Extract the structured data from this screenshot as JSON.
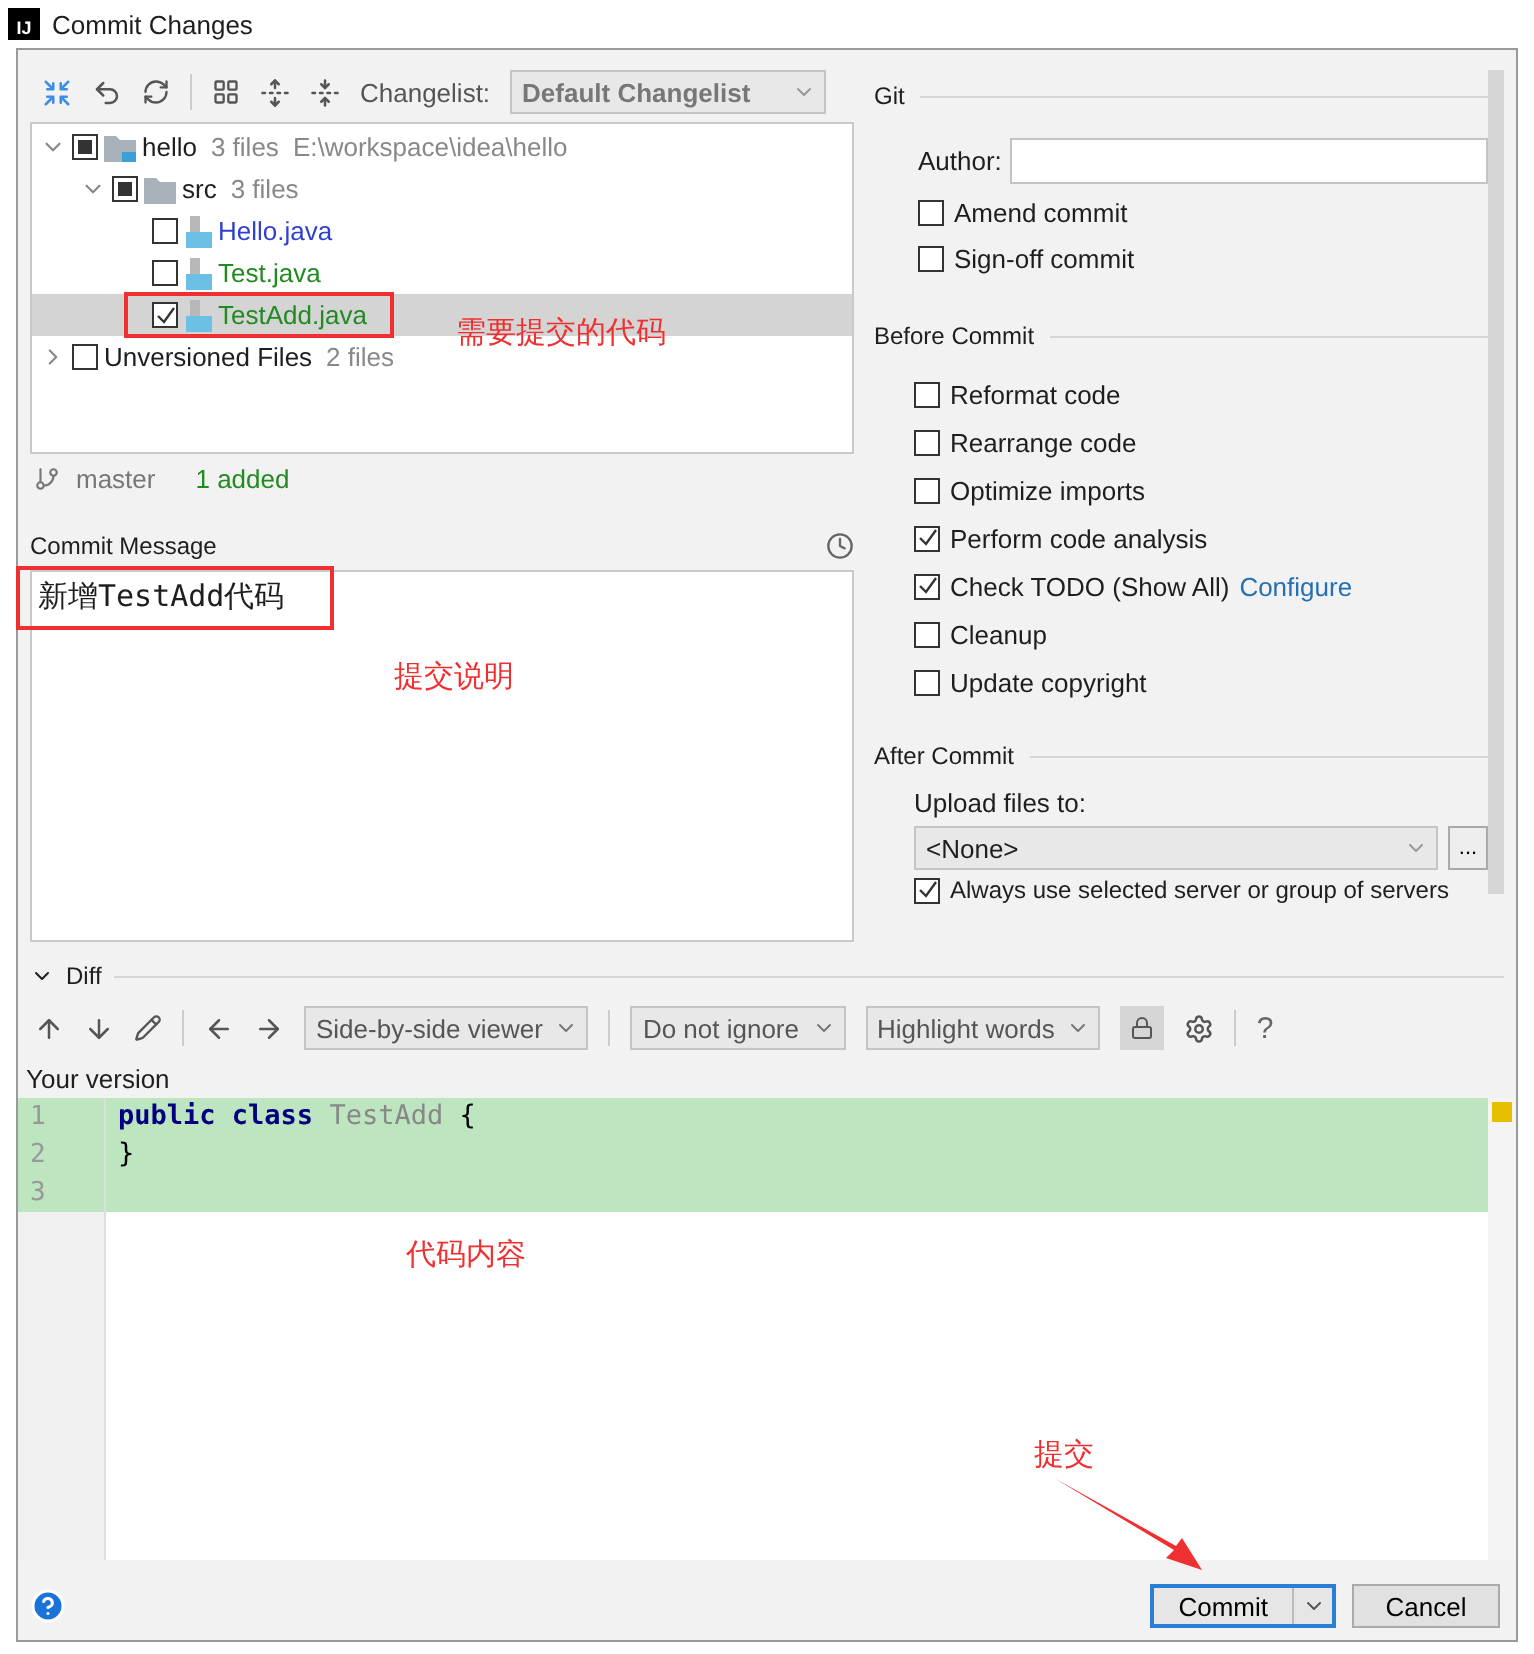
{
  "window": {
    "title": "Commit Changes",
    "app_badge": "IJ"
  },
  "toolbar": {
    "changelist_label": "Changelist:",
    "changelist": "Default Changelist"
  },
  "tree": [
    {
      "name": "hello",
      "meta": "3 files",
      "path": "E:\\workspace\\idea\\hello",
      "kind": "module",
      "expanded": true,
      "partial": true,
      "selected": false,
      "children": [
        {
          "name": "src",
          "meta": "3 files",
          "kind": "folder",
          "expanded": true,
          "partial": true,
          "selected": false,
          "children": [
            {
              "name": "Hello.java",
              "kind": "file",
              "color": "#2f3fcf",
              "checked": false,
              "selected": false
            },
            {
              "name": "Test.java",
              "kind": "file",
              "color": "#218a21",
              "checked": false,
              "selected": false
            },
            {
              "name": "TestAdd.java",
              "kind": "file",
              "color": "#218a21",
              "checked": true,
              "selected": true
            }
          ]
        }
      ]
    },
    {
      "name": "Unversioned Files",
      "meta": "2 files",
      "kind": "group",
      "expanded": false,
      "checked": false,
      "selected": false
    }
  ],
  "branch": {
    "name": "master",
    "summary": "1 added"
  },
  "commit_message": {
    "label": "Commit Message",
    "value": "新增TestAdd代码"
  },
  "git": {
    "title": "Git",
    "author_label": "Author:",
    "options": [
      {
        "label": "Amend commit",
        "checked": false
      },
      {
        "label": "Sign-off commit",
        "checked": false
      }
    ]
  },
  "before_commit": {
    "title": "Before Commit",
    "options": [
      {
        "label": "Reformat code",
        "checked": false
      },
      {
        "label": "Rearrange code",
        "checked": false
      },
      {
        "label": "Optimize imports",
        "checked": false
      },
      {
        "label": "Perform code analysis",
        "checked": true
      },
      {
        "label": "Check TODO (Show All)",
        "checked": true,
        "link": "Configure"
      },
      {
        "label": "Cleanup",
        "checked": false
      },
      {
        "label": "Update copyright",
        "checked": false
      }
    ]
  },
  "after_commit": {
    "title": "After Commit",
    "upload_label": "Upload files to:",
    "upload_value": "<None>",
    "browse": "...",
    "options": [
      {
        "label": "Always use selected server or group of servers",
        "checked": true
      }
    ]
  },
  "diff": {
    "title": "Diff",
    "expanded": true,
    "viewer": "Side-by-side viewer",
    "ignore": "Do not ignore",
    "highlight": "Highlight words",
    "help": "?",
    "version_label": "Your version",
    "lines": [
      {
        "number": "1",
        "tokens": [
          {
            "text": "public",
            "kind": "keyword"
          },
          {
            "text": "class",
            "kind": "keyword"
          },
          {
            "text": "TestAdd",
            "kind": "name"
          },
          {
            "text": "{",
            "kind": "plain"
          }
        ]
      },
      {
        "number": "2",
        "tokens": [
          {
            "text": "}",
            "kind": "plain"
          }
        ]
      },
      {
        "number": "3"
      }
    ]
  },
  "buttons": {
    "commit": "Commit",
    "cancel": "Cancel"
  },
  "annotations": [
    {
      "kind": "frame"
    },
    {
      "kind": "label",
      "text": "需要提交的代码"
    },
    {
      "kind": "frame"
    },
    {
      "kind": "label",
      "text": "提交说明"
    },
    {
      "kind": "label",
      "text": "代码内容"
    },
    {
      "kind": "label",
      "text": "提交"
    },
    {
      "kind": "arrow"
    }
  ]
}
